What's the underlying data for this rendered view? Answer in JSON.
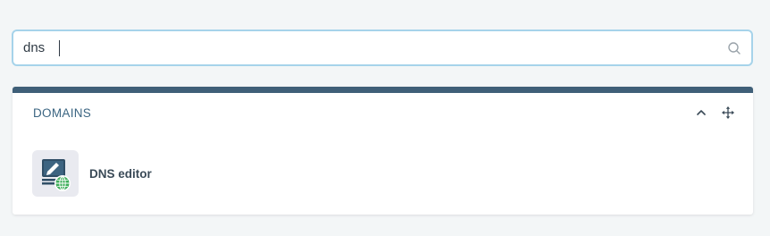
{
  "search": {
    "value": "dns",
    "icon": "search-icon"
  },
  "panel": {
    "title": "DOMAINS",
    "accent_color": "#3f5f78",
    "controls": {
      "collapse_icon": "chevron-up-icon",
      "move_icon": "move-icon"
    },
    "items": [
      {
        "label": "DNS editor",
        "icon": "dns-editor-icon"
      }
    ]
  },
  "colors": {
    "search_border": "#a6d3ea",
    "title_text": "#3b6582",
    "globe": "#3fae5a"
  }
}
